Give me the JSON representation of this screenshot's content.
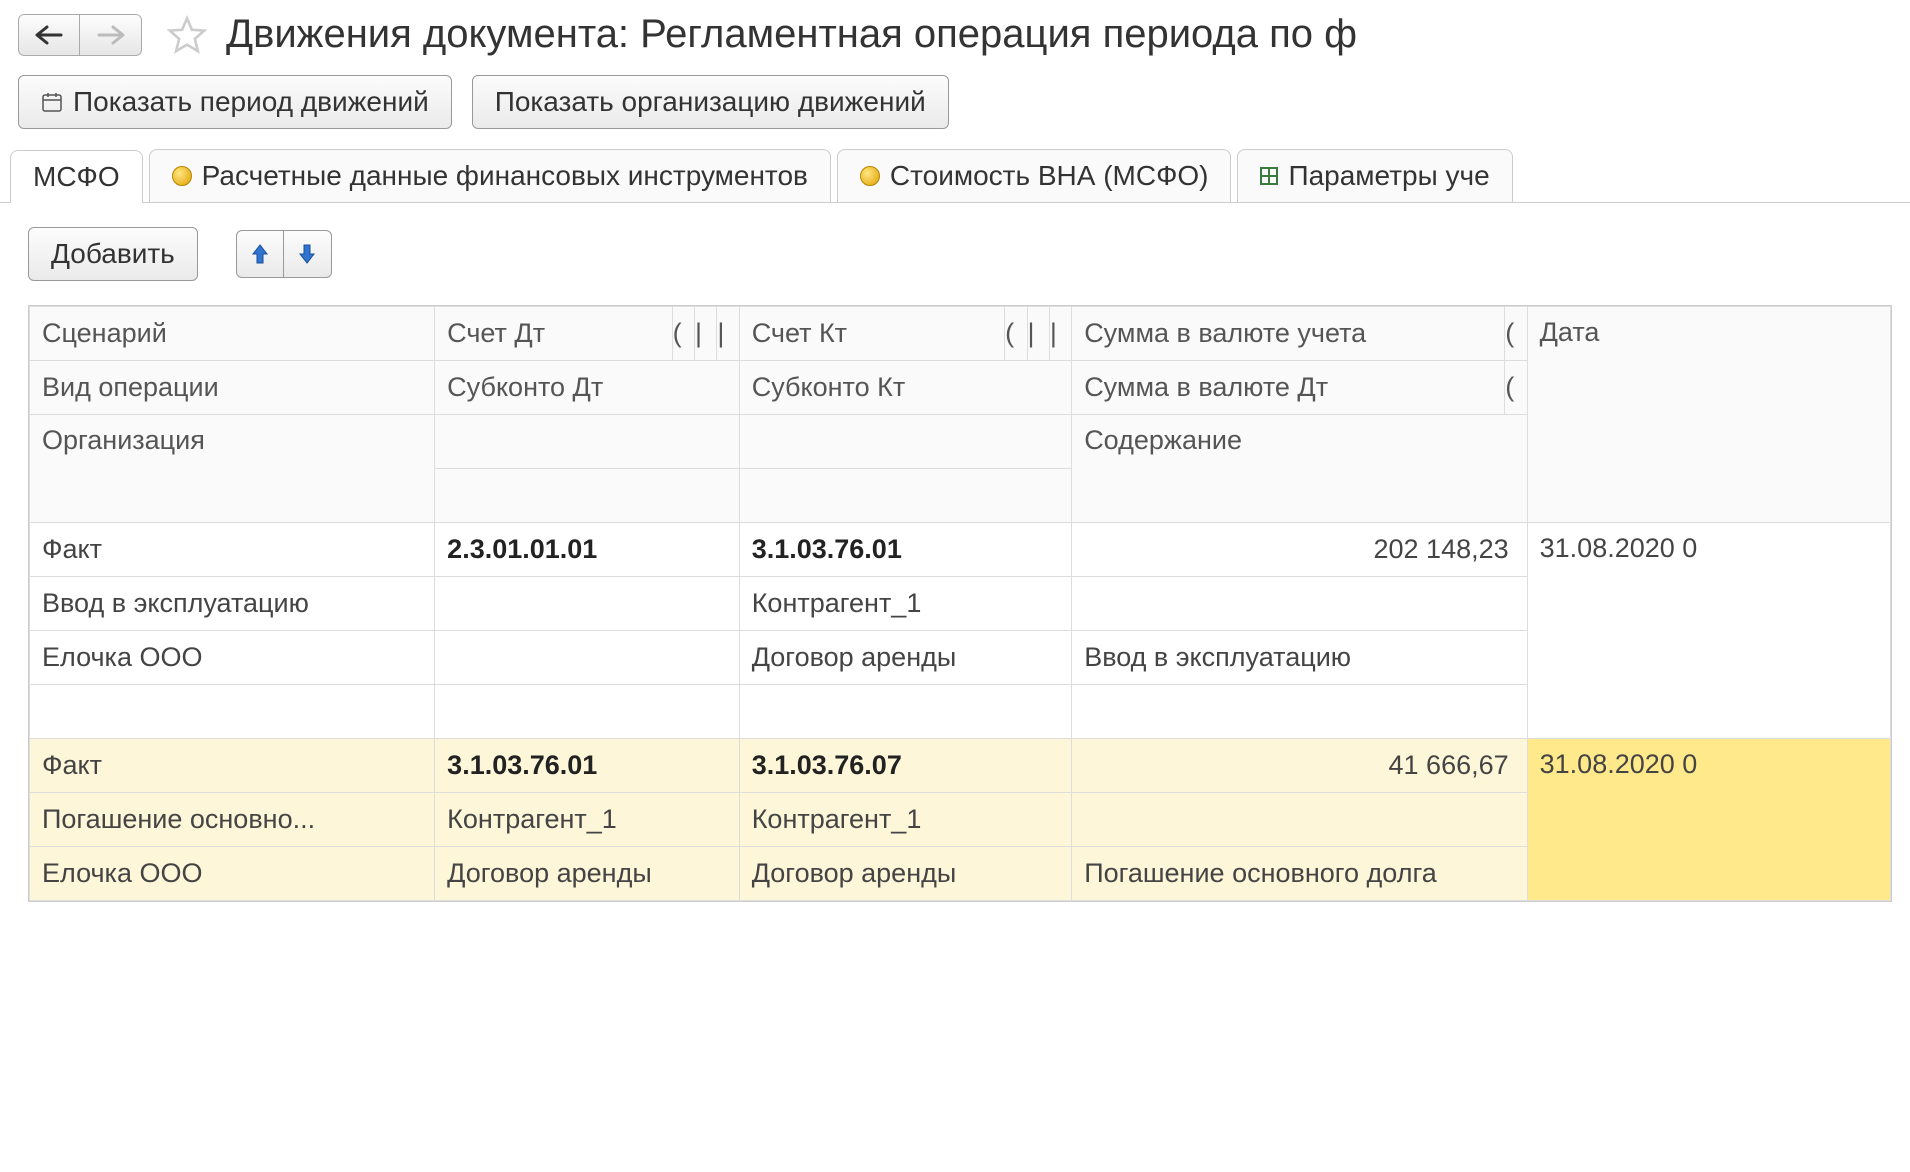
{
  "header": {
    "title": "Движения документа: Регламентная операция периода по ф"
  },
  "toolbar": {
    "show_period": "Показать период движений",
    "show_org": "Показать организацию движений"
  },
  "tabs": [
    {
      "label": "МСФО"
    },
    {
      "label": "Расчетные данные финансовых инструментов"
    },
    {
      "label": "Стоимость ВНА (МСФО)"
    },
    {
      "label": "Параметры уче"
    }
  ],
  "actions": {
    "add": "Добавить"
  },
  "table": {
    "headers": {
      "r1": {
        "c1": "Сценарий",
        "c2": "Счет Дт",
        "c3": "Счет Кт",
        "c4": "Сумма в валюте учета",
        "c5": "Дата"
      },
      "r2": {
        "c1": "Вид операции",
        "c2": "Субконто Дт",
        "c3": "Субконто Кт",
        "c4": "Сумма в валюте Дт"
      },
      "r3": {
        "c1": "Организация",
        "c4": "Содержание"
      }
    },
    "rows": [
      {
        "hl": false,
        "r1": {
          "c1": "Факт",
          "c2": "2.3.01.01.01",
          "c3": "3.1.03.76.01",
          "c4": "202 148,23",
          "c5": "31.08.2020 0"
        },
        "r2": {
          "c1": "Ввод в эксплуатацию",
          "c2": "",
          "c3": "Контрагент_1",
          "c4": ""
        },
        "r3": {
          "c1": "Елочка ООО",
          "c2": "",
          "c3": "Договор аренды",
          "c4": "Ввод в эксплуатацию"
        },
        "r4": {
          "c1": "",
          "c2": "",
          "c3": "",
          "c4": ""
        }
      },
      {
        "hl": true,
        "r1": {
          "c1": "Факт",
          "c2": "3.1.03.76.01",
          "c3": "3.1.03.76.07",
          "c4": "41 666,67",
          "c5": "31.08.2020 0"
        },
        "r2": {
          "c1": "Погашение основно...",
          "c2": "Контрагент_1",
          "c3": "Контрагент_1",
          "c4": ""
        },
        "r3": {
          "c1": "Елочка ООО",
          "c2": "Договор аренды",
          "c3": "Договор аренды",
          "c4": "Погашение основного долга"
        }
      }
    ]
  }
}
